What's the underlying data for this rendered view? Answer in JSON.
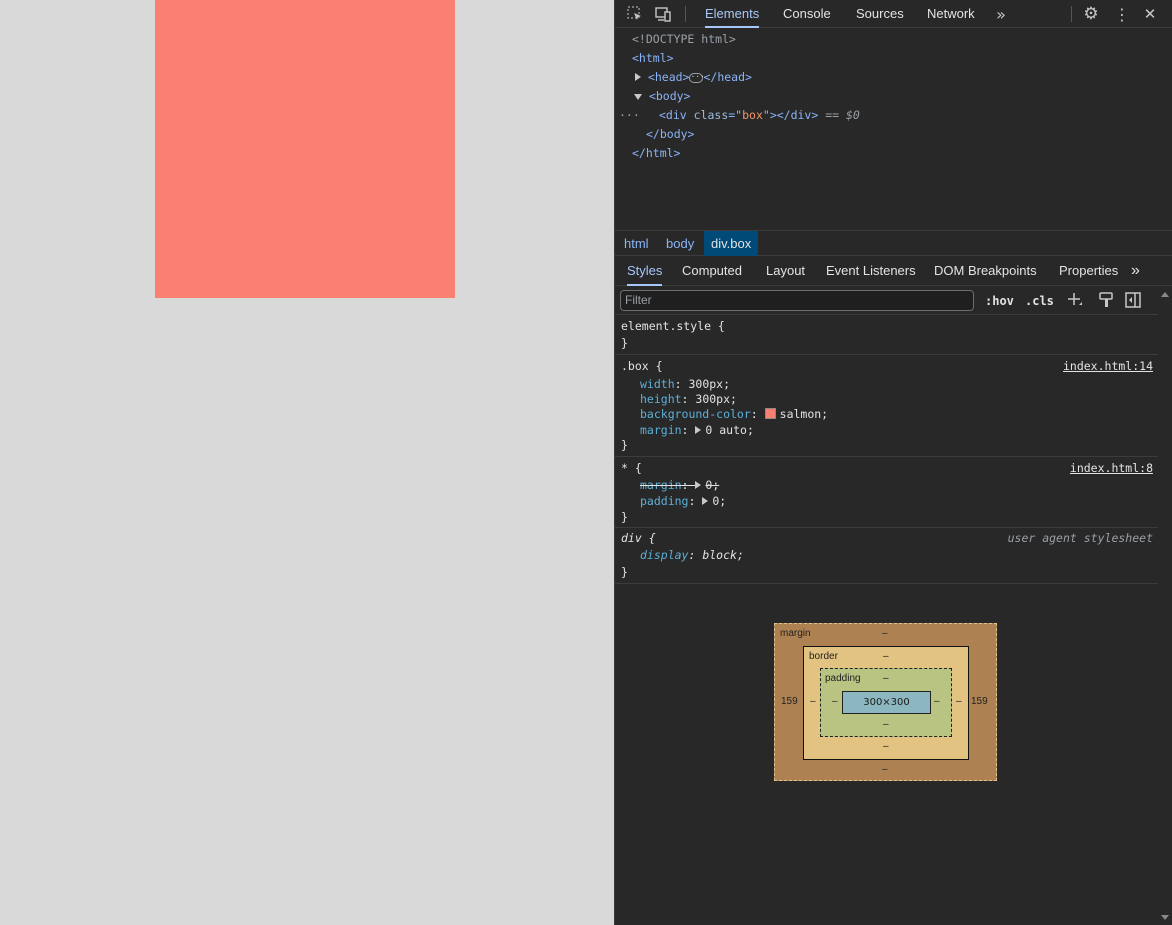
{
  "viewport": {
    "box_color": "#fa8072"
  },
  "devtools": {
    "tabs": [
      "Elements",
      "Console",
      "Sources",
      "Network"
    ],
    "icons": {
      "inspect": "inspect-element-icon",
      "device": "device-toolbar-icon",
      "more_tabs": "»",
      "settings": "⚙",
      "kebab": "⋮",
      "close": "✕"
    },
    "tree": {
      "doctype": "<!DOCTYPE html>",
      "html_open": "<html>",
      "head": "<head>",
      "head_close": "</head>",
      "body_open": "<body>",
      "div_tag_open": "<div ",
      "div_attr_name": "class",
      "div_attr_eq": "=\"",
      "div_attr_value": "box",
      "div_attr_end": "\"></div>",
      "dollar": " == $0",
      "body_close": "</body>",
      "html_close": "</html>",
      "dots": "···"
    },
    "breadcrumbs": [
      "html",
      "body",
      "div.box"
    ],
    "sidebar_tabs": [
      "Styles",
      "Computed",
      "Layout",
      "Event Listeners",
      "DOM Breakpoints",
      "Properties"
    ],
    "filter_placeholder": "Filter",
    "hov": ":hov",
    "cls": ".cls",
    "styles": {
      "element_style": "element.style {",
      "close_brace": "}",
      "box_selector": ".box {",
      "box_source": "index.html:14",
      "box_props": [
        {
          "name": "width",
          "value": "300px;"
        },
        {
          "name": "height",
          "value": "300px;"
        },
        {
          "name": "background-color",
          "value": "salmon;"
        },
        {
          "name": "margin",
          "value": "0 auto;"
        }
      ],
      "star_selector": "* {",
      "star_source": "index.html:8",
      "star_props": [
        {
          "name": "margin",
          "value": "0;"
        },
        {
          "name": "padding",
          "value": "0;"
        }
      ],
      "div_selector": "div {",
      "div_source": "user agent stylesheet",
      "div_props": [
        {
          "name": "display",
          "value": "block;"
        }
      ]
    },
    "box_model": {
      "margin_label": "margin",
      "border_label": "border",
      "padding_label": "padding",
      "content": "300×300",
      "dash": "–",
      "margin_left": "159",
      "margin_right": "159"
    }
  }
}
